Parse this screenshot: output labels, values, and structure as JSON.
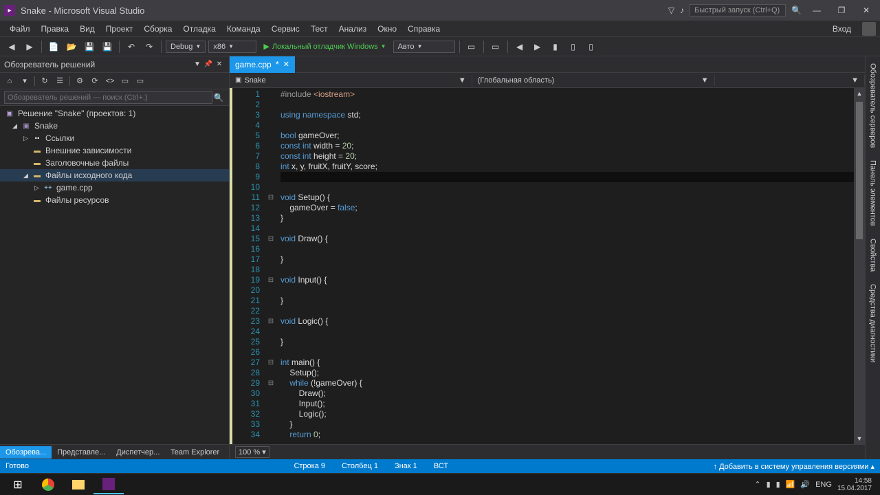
{
  "titlebar": {
    "app_title": "Snake - Microsoft Visual Studio",
    "quick_launch_placeholder": "Быстрый запуск (Ctrl+Q)"
  },
  "menubar": {
    "items": [
      "Файл",
      "Правка",
      "Вид",
      "Проект",
      "Сборка",
      "Отладка",
      "Команда",
      "Сервис",
      "Тест",
      "Анализ",
      "Окно",
      "Справка"
    ],
    "login": "Вход"
  },
  "toolbar": {
    "config": "Debug",
    "platform": "x86",
    "start_label": "Локальный отладчик Windows",
    "mode": "Авто"
  },
  "solution_explorer": {
    "title": "Обозреватель решений",
    "search_placeholder": "Обозреватель решений — поиск (Ctrl+;)",
    "solution_label": "Решение \"Snake\" (проектов: 1)",
    "project": "Snake",
    "folders": {
      "references": "Ссылки",
      "external_deps": "Внешние зависимости",
      "headers": "Заголовочные файлы",
      "source": "Файлы исходного кода",
      "resources": "Файлы ресурсов"
    },
    "source_file": "game.cpp"
  },
  "bottom_tabs": {
    "items": [
      "Обозрева...",
      "Представле...",
      "Диспетчер...",
      "Team Explorer"
    ]
  },
  "editor": {
    "tab_name": "game.cpp",
    "context_left": "Snake",
    "context_right": "(Глобальная область)",
    "zoom": "100 %",
    "code_lines": [
      {
        "n": 1,
        "fold": "",
        "tokens": [
          [
            "pp",
            "#include "
          ],
          [
            "str",
            "<iostream>"
          ]
        ]
      },
      {
        "n": 2,
        "fold": "",
        "tokens": []
      },
      {
        "n": 3,
        "fold": "",
        "tokens": [
          [
            "kw",
            "using "
          ],
          [
            "kw",
            "namespace "
          ],
          [
            "fn",
            "std"
          ],
          [
            "op",
            ";"
          ]
        ]
      },
      {
        "n": 4,
        "fold": "",
        "tokens": []
      },
      {
        "n": 5,
        "fold": "",
        "tokens": [
          [
            "kw",
            "bool "
          ],
          [
            "fn",
            "gameOver"
          ],
          [
            "op",
            ";"
          ]
        ]
      },
      {
        "n": 6,
        "fold": "",
        "tokens": [
          [
            "kw",
            "const "
          ],
          [
            "kw",
            "int "
          ],
          [
            "fn",
            "width = "
          ],
          [
            "num",
            "20"
          ],
          [
            "op",
            ";"
          ]
        ]
      },
      {
        "n": 7,
        "fold": "",
        "tokens": [
          [
            "kw",
            "const "
          ],
          [
            "kw",
            "int "
          ],
          [
            "fn",
            "height = "
          ],
          [
            "num",
            "20"
          ],
          [
            "op",
            ";"
          ]
        ]
      },
      {
        "n": 8,
        "fold": "",
        "tokens": [
          [
            "kw",
            "int "
          ],
          [
            "fn",
            "x, y, fruitX, fruitY, score"
          ],
          [
            "op",
            ";"
          ]
        ]
      },
      {
        "n": 9,
        "fold": "",
        "hl": true,
        "tokens": []
      },
      {
        "n": 10,
        "fold": "",
        "tokens": []
      },
      {
        "n": 11,
        "fold": "⊟",
        "tokens": [
          [
            "kw",
            "void "
          ],
          [
            "fn",
            "Setup() {"
          ]
        ]
      },
      {
        "n": 12,
        "fold": "",
        "tokens": [
          [
            "fn",
            "    gameOver = "
          ],
          [
            "kw",
            "false"
          ],
          [
            "op",
            ";"
          ]
        ]
      },
      {
        "n": 13,
        "fold": "",
        "tokens": [
          [
            "fn",
            "}"
          ]
        ]
      },
      {
        "n": 14,
        "fold": "",
        "tokens": []
      },
      {
        "n": 15,
        "fold": "⊟",
        "tokens": [
          [
            "kw",
            "void "
          ],
          [
            "fn",
            "Draw() {"
          ]
        ]
      },
      {
        "n": 16,
        "fold": "",
        "tokens": []
      },
      {
        "n": 17,
        "fold": "",
        "tokens": [
          [
            "fn",
            "}"
          ]
        ]
      },
      {
        "n": 18,
        "fold": "",
        "tokens": []
      },
      {
        "n": 19,
        "fold": "⊟",
        "tokens": [
          [
            "kw",
            "void "
          ],
          [
            "fn",
            "Input() {"
          ]
        ]
      },
      {
        "n": 20,
        "fold": "",
        "tokens": []
      },
      {
        "n": 21,
        "fold": "",
        "tokens": [
          [
            "fn",
            "}"
          ]
        ]
      },
      {
        "n": 22,
        "fold": "",
        "tokens": []
      },
      {
        "n": 23,
        "fold": "⊟",
        "tokens": [
          [
            "kw",
            "void "
          ],
          [
            "fn",
            "Logic() {"
          ]
        ]
      },
      {
        "n": 24,
        "fold": "",
        "tokens": []
      },
      {
        "n": 25,
        "fold": "",
        "tokens": [
          [
            "fn",
            "}"
          ]
        ]
      },
      {
        "n": 26,
        "fold": "",
        "tokens": []
      },
      {
        "n": 27,
        "fold": "⊟",
        "tokens": [
          [
            "kw",
            "int "
          ],
          [
            "fn",
            "main() {"
          ]
        ]
      },
      {
        "n": 28,
        "fold": "",
        "tokens": [
          [
            "fn",
            "    Setup();"
          ]
        ]
      },
      {
        "n": 29,
        "fold": "⊟",
        "tokens": [
          [
            "fn",
            "    "
          ],
          [
            "kw",
            "while "
          ],
          [
            "fn",
            "(!gameOver) {"
          ]
        ]
      },
      {
        "n": 30,
        "fold": "",
        "tokens": [
          [
            "fn",
            "        Draw();"
          ]
        ]
      },
      {
        "n": 31,
        "fold": "",
        "tokens": [
          [
            "fn",
            "        Input();"
          ]
        ]
      },
      {
        "n": 32,
        "fold": "",
        "tokens": [
          [
            "fn",
            "        Logic();"
          ]
        ]
      },
      {
        "n": 33,
        "fold": "",
        "tokens": [
          [
            "fn",
            "    }"
          ]
        ]
      },
      {
        "n": 34,
        "fold": "",
        "tokens": [
          [
            "fn",
            "    "
          ],
          [
            "kw",
            "return "
          ],
          [
            "num",
            "0"
          ],
          [
            "op",
            ";"
          ]
        ]
      }
    ]
  },
  "right_panels": [
    "Обозреватель серверов",
    "Панель элементов",
    "Свойства",
    "Средства диагностики"
  ],
  "statusbar": {
    "ready": "Готово",
    "line": "Строка 9",
    "col": "Столбец 1",
    "char": "Знак 1",
    "ins": "ВСТ",
    "source_control": "Добавить в систему управления версиями"
  },
  "taskbar": {
    "lang": "ENG",
    "time": "14:58",
    "date": "15.04.2017"
  }
}
